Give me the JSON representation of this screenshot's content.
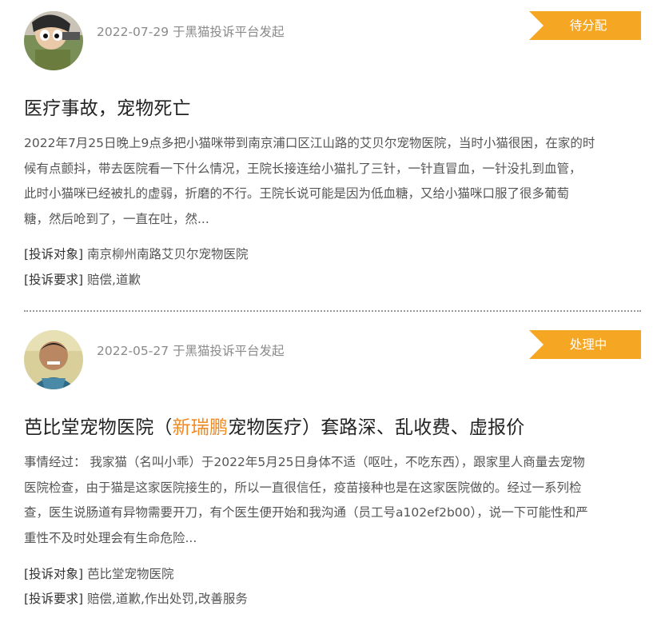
{
  "complaints": [
    {
      "meta": "2022-07-29 于黑猫投诉平台发起",
      "status": "待分配",
      "title": "医疗事故，宠物死亡",
      "body_lines": [
        "2022年7月25日晚上9点多把小猫咪带到南京浦口区江山路的艾贝尔宠物医院，当时小猫很困，在家的时",
        "候有点颤抖，带去医院看一下什么情况，王院长接连给小猫扎了三针，一针直冒血，一针没扎到血管，",
        "此时小猫咪已经被扎的虚弱，折磨的不行。王院长说可能是因为低血糖，又给小猫咪口服了很多葡萄",
        "糖，然后呛到了，一直在吐，然..."
      ],
      "target_label": "[投诉对象]",
      "target_value": "南京柳州南路艾贝尔宠物医院",
      "demand_label": "[投诉要求]",
      "demand_value": "赔偿,道歉"
    },
    {
      "meta": "2022-05-27 于黑猫投诉平台发起",
      "status": "处理中",
      "title_pre": "芭比堂宠物医院（",
      "title_highlight": "新瑞鹏",
      "title_post": "宠物医疗）套路深、乱收费、虚报价",
      "body_lines": [
        "事情经过： 我家猫（名叫小乖）于2022年5月25日身体不适（呕吐，不吃东西），跟家里人商量去宠物",
        "医院检查，由于猫是这家医院接生的，所以一直很信任，疫苗接种也是在这家医院做的。经过一系列检",
        "查，医生说肠道有异物需要开刀，有个医生便开始和我沟通（员工号a102ef2b00），说一下可能性和严",
        "重性不及时处理会有生命危险..."
      ],
      "target_label": "[投诉对象]",
      "target_value": "芭比堂宠物医院",
      "demand_label": "[投诉要求]",
      "demand_value": "赔偿,道歉,作出处罚,改善服务"
    }
  ],
  "colors": {
    "status_bg": "#f5a623",
    "highlight": "#f08a24",
    "meta_text": "#8a8a8a"
  }
}
